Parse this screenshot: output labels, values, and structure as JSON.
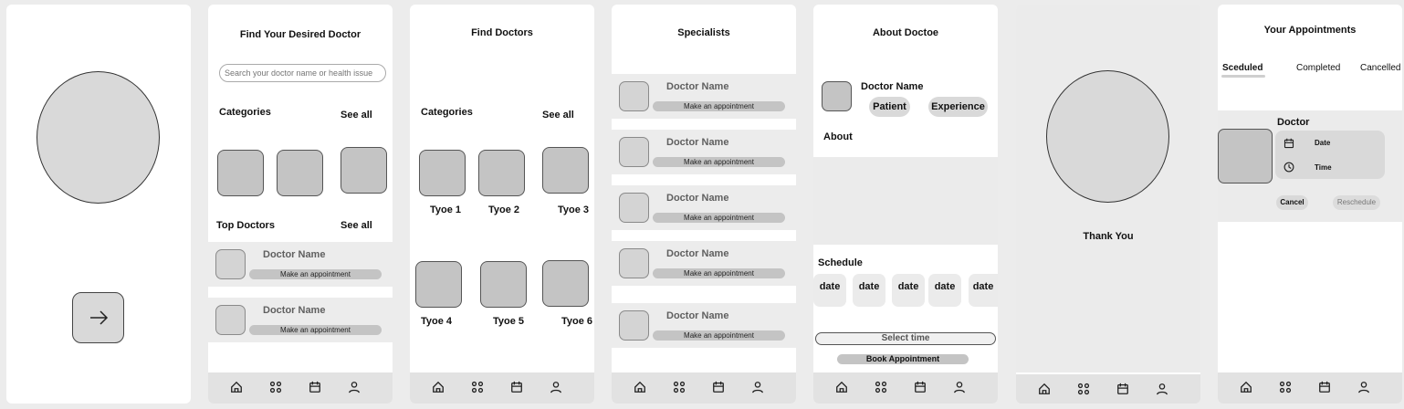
{
  "screen_search": {
    "title": "Find Your Desired Doctor",
    "search_placeholder": "Search your doctor name or health issue",
    "categories_label": "Categories",
    "see_all": "See all",
    "top_doctors_label": "Top Doctors",
    "top_see_all": "See all",
    "doctors": [
      {
        "name": "Doctor Name",
        "action": "Make an appointment"
      },
      {
        "name": "Doctor Name",
        "action": "Make an appointment"
      }
    ]
  },
  "screen_find": {
    "title": "Find Doctors",
    "categories_label": "Categories",
    "see_all": "See all",
    "types": [
      "Tyoe 1",
      "Tyoe 2",
      "Tyoe 3",
      "Tyoe 4",
      "Tyoe 5",
      "Tyoe 6"
    ]
  },
  "screen_specialists": {
    "title": "Specialists",
    "doctors": [
      {
        "name": "Doctor Name",
        "action": "Make an appointment"
      },
      {
        "name": "Doctor Name",
        "action": "Make an appointment"
      },
      {
        "name": "Doctor Name",
        "action": "Make an appointment"
      },
      {
        "name": "Doctor Name",
        "action": "Make an appointment"
      },
      {
        "name": "Doctor Name",
        "action": "Make an appointment"
      }
    ]
  },
  "screen_about": {
    "title": "About Doctoe",
    "doctor_name": "Doctor Name",
    "patient": "Patient",
    "experience": "Experience",
    "about_label": "About",
    "schedule_label": "Schedule",
    "dates": [
      "date",
      "date",
      "date",
      "date",
      "date"
    ],
    "select_time": "Select time",
    "book": "Book Appointment"
  },
  "screen_thanks": {
    "message": "Thank You"
  },
  "screen_appointments": {
    "title": "Your Appointments",
    "tabs": [
      "Sceduled",
      "Completed",
      "Cancelled"
    ],
    "doctor_label": "Doctor",
    "date_label": "Date",
    "time_label": "Time",
    "cancel": "Cancel",
    "reschedule": "Reschedule"
  },
  "nav_icons": [
    "home-icon",
    "grid-icon",
    "calendar-icon",
    "profile-icon"
  ]
}
